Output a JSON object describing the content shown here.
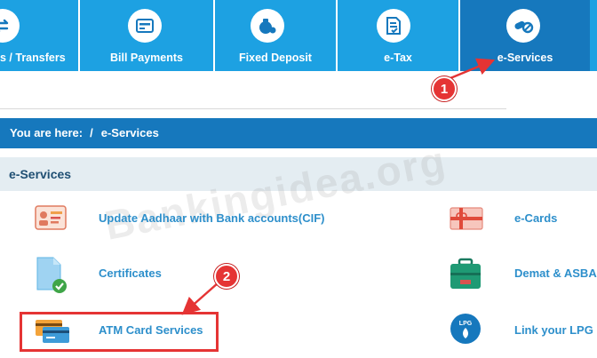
{
  "nav": {
    "items": [
      {
        "label": "s / Transfers",
        "icon": "transfer-arrows-icon"
      },
      {
        "label": "Bill Payments",
        "icon": "bill-card-icon"
      },
      {
        "label": "Fixed Deposit",
        "icon": "money-bag-icon"
      },
      {
        "label": "e-Tax",
        "icon": "tax-document-icon"
      },
      {
        "label": "e-Services",
        "icon": "pills-icon",
        "active": true
      }
    ]
  },
  "breadcrumb": {
    "prefix": "You are here:",
    "separator": "/",
    "current": "e-Services"
  },
  "section": {
    "title": "e-Services"
  },
  "services": {
    "left": [
      {
        "label": "Update Aadhaar with Bank accounts(CIF)",
        "icon": "aadhaar-card-icon"
      },
      {
        "label": "Certificates",
        "icon": "certificate-document-icon"
      },
      {
        "label": "ATM Card Services",
        "icon": "atm-cards-icon"
      }
    ],
    "right": [
      {
        "label": "e-Cards",
        "icon": "gift-card-icon"
      },
      {
        "label": "Demat & ASBA",
        "icon": "briefcase-icon"
      },
      {
        "label": "Link your LPG",
        "icon": "lpg-flame-icon"
      }
    ]
  },
  "annotations": {
    "step1": "1",
    "step2": "2"
  },
  "watermark": "Bankingidea.org",
  "colors": {
    "nav_bg": "#1da1e2",
    "nav_active": "#1678bd",
    "breadcrumb_bg": "#1678bd",
    "section_bg": "#e4edf2",
    "link": "#2d8fcb",
    "annotation": "#e53434"
  }
}
